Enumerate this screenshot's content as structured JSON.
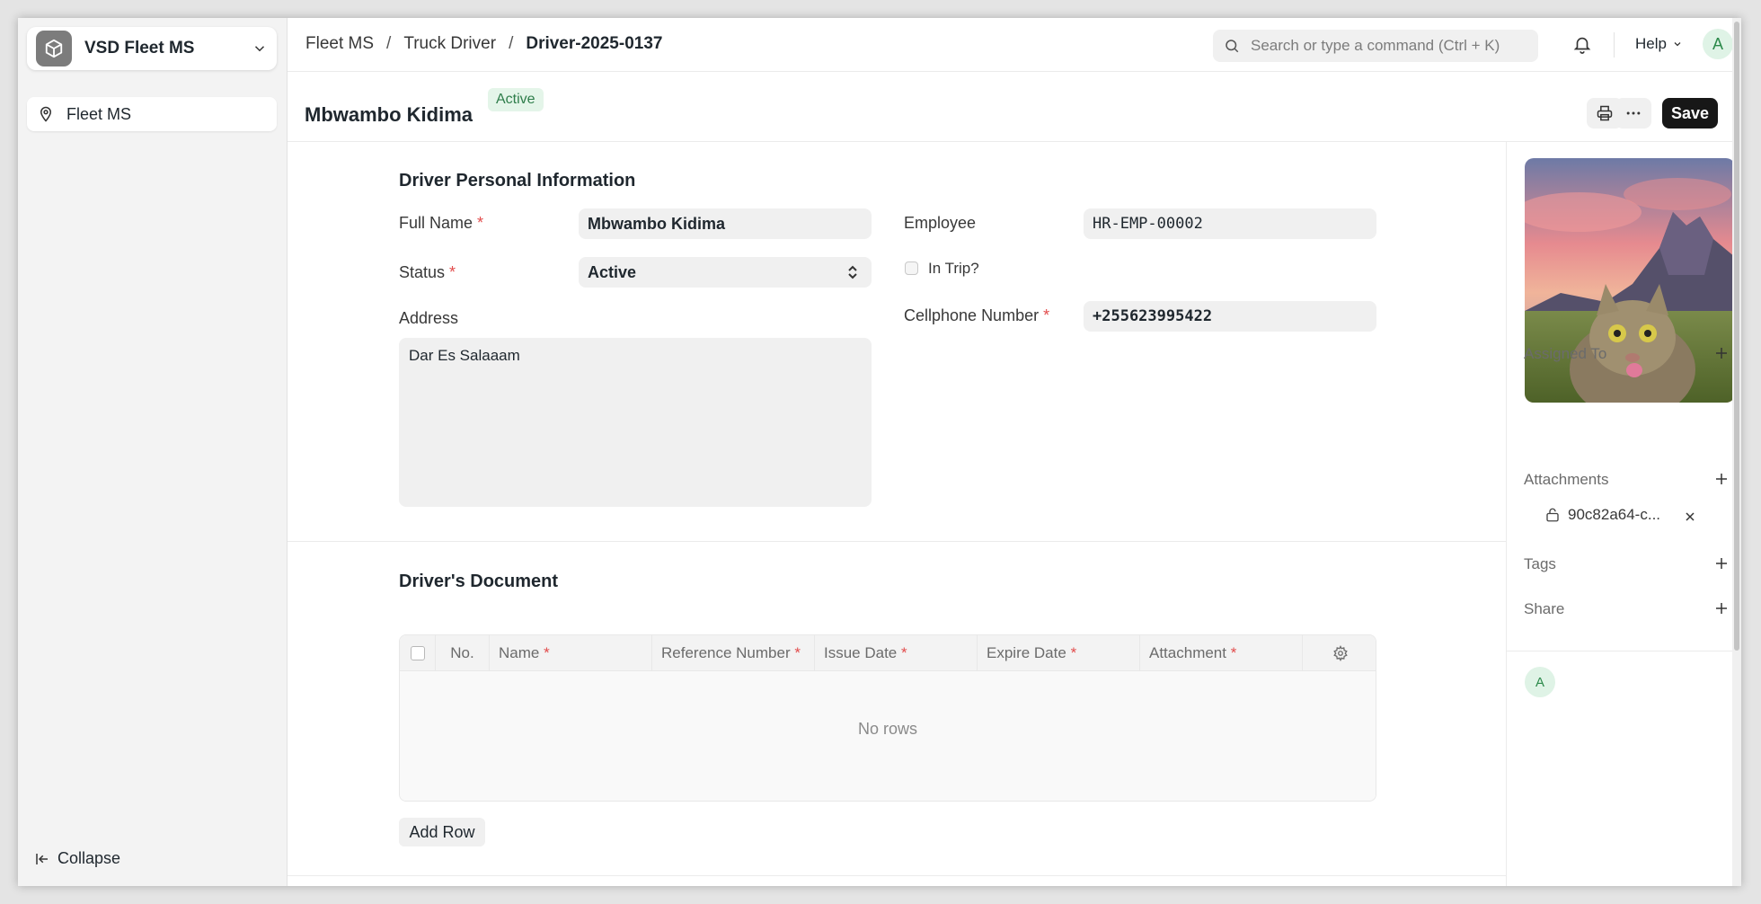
{
  "sidebar": {
    "app_name": "VSD Fleet MS",
    "nav_items": [
      {
        "label": "Fleet MS"
      }
    ],
    "collapse_label": "Collapse"
  },
  "topbar": {
    "breadcrumb": [
      "Fleet MS",
      "Truck Driver",
      "Driver-2025-0137"
    ],
    "search_placeholder": "Search or type a command (Ctrl + K)",
    "help_label": "Help",
    "avatar_initial": "A"
  },
  "page": {
    "title": "Mbwambo Kidima",
    "status": "Active",
    "save_label": "Save"
  },
  "form": {
    "section_personal": "Driver Personal Information",
    "full_name_label": "Full Name",
    "full_name_value": "Mbwambo Kidima",
    "status_label": "Status",
    "status_value": "Active",
    "address_label": "Address",
    "address_value": "Dar Es Salaaam",
    "employee_label": "Employee",
    "employee_value": "HR-EMP-00002",
    "in_trip_label": "In Trip?",
    "in_trip_checked": false,
    "cellphone_label": "Cellphone Number",
    "cellphone_value": "+255623995422",
    "required_mark": "*",
    "section_documents": "Driver's Document",
    "table_columns": [
      "No.",
      "Name",
      "Reference Number",
      "Issue Date",
      "Expire Date",
      "Attachment"
    ],
    "no_rows_text": "No rows",
    "add_row_label": "Add Row"
  },
  "rightbar": {
    "assigned_to_label": "Assigned To",
    "attachments_label": "Attachments",
    "attachment_name": "90c82a64-c...",
    "tags_label": "Tags",
    "share_label": "Share",
    "avatar_initial": "A"
  },
  "colors": {
    "accent": "#171717",
    "status_bg": "#e4f5e9",
    "status_text": "#2e7d4a",
    "required": "#e24c4c",
    "avatar_bg": "#dff3e6"
  }
}
